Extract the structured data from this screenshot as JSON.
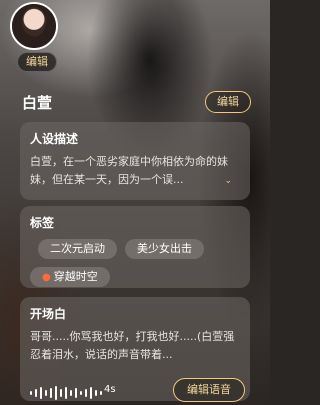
{
  "avatar": {
    "edit_label": "编辑"
  },
  "header": {
    "name": "白萱",
    "edit_label": "编辑"
  },
  "persona": {
    "title": "人设描述",
    "text": "白萱，在一个恶劣家庭中你相依为命的妹妹，但在某一天，因为一个误..."
  },
  "tags": {
    "title": "标签",
    "items": [
      "二次元启动",
      "美少女出击",
      "穿越时空"
    ]
  },
  "opening": {
    "title": "开场白",
    "text": "哥哥.....你骂我也好，打我也好.....(白萱强忍着泪水，说话的声音带着...",
    "duration": "4s",
    "voice_label": "编辑语音"
  },
  "accent_color": "#f4c77a"
}
